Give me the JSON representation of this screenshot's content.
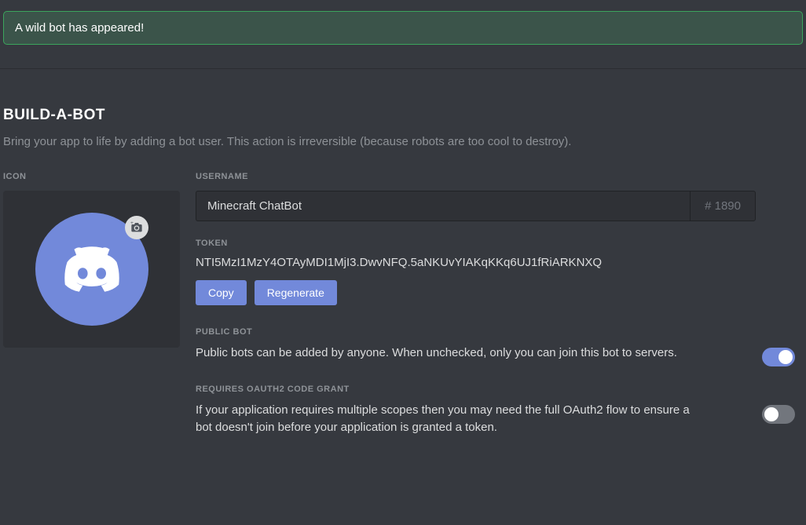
{
  "notification": {
    "message": "A wild bot has appeared!"
  },
  "section": {
    "title": "BUILD-A-BOT",
    "subtitle": "Bring your app to life by adding a bot user. This action is irreversible (because robots are too cool to destroy)."
  },
  "labels": {
    "icon": "ICON",
    "username": "USERNAME",
    "token": "TOKEN",
    "publicBot": "PUBLIC BOT",
    "oauthGrant": "REQUIRES OAUTH2 CODE GRANT"
  },
  "username": {
    "value": "Minecraft ChatBot",
    "discriminator": "# 1890"
  },
  "token": {
    "value": "NTI5MzI1MzY4OTAyMDI1MjI3.DwvNFQ.5aNKUvYIAKqKKq6UJ1fRiARKNXQ",
    "copyLabel": "Copy",
    "regenerateLabel": "Regenerate"
  },
  "settings": {
    "publicBot": {
      "description": "Public bots can be added by anyone. When unchecked, only you can join this bot to servers.",
      "enabled": true
    },
    "oauthGrant": {
      "description": "If your application requires multiple scopes then you may need the full OAuth2 flow to ensure a bot doesn't join before your application is granted a token.",
      "enabled": false
    }
  }
}
